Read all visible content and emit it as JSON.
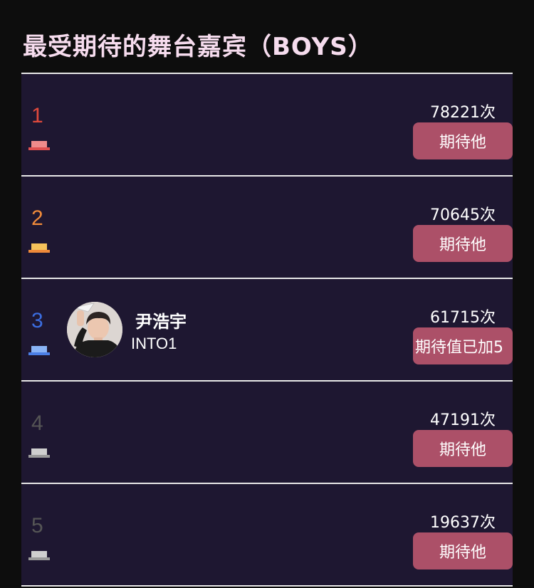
{
  "title": "最受期待的舞台嘉宾（BOYS）",
  "colors": {
    "background": "#0d0d0d",
    "row_background": "#1e1731",
    "divider": "#e8e8e8",
    "button": "#ac5068",
    "title": "#f6dcee"
  },
  "rows": [
    {
      "rank": "1",
      "rank_color": "#e0493c",
      "podium_top_color": "#f08b8b",
      "podium_base_color": "#e05050",
      "name": "",
      "group": "",
      "count": "78221次",
      "button_label": "期待他"
    },
    {
      "rank": "2",
      "rank_color": "#ef8a3a",
      "podium_top_color": "#f5c25a",
      "podium_base_color": "#ef8a3a",
      "name": "",
      "group": "",
      "count": "70645次",
      "button_label": "期待他"
    },
    {
      "rank": "3",
      "rank_color": "#3b6de0",
      "podium_top_color": "#8ab4f6",
      "podium_base_color": "#4b7fe6",
      "name": "尹浩宇",
      "group": "INTO1",
      "avatar_icon": "person-avatar",
      "count": "61715次",
      "button_label": "期待值已加5"
    },
    {
      "rank": "4",
      "rank_color": "#555555",
      "podium_top_color": "#cfcfcf",
      "podium_base_color": "#9a9a9a",
      "name": "",
      "group": "",
      "count": "47191次",
      "button_label": "期待他"
    },
    {
      "rank": "5",
      "rank_color": "#555555",
      "podium_top_color": "#cfcfcf",
      "podium_base_color": "#9a9a9a",
      "name": "",
      "group": "",
      "count": "19637次",
      "button_label": "期待他"
    }
  ]
}
